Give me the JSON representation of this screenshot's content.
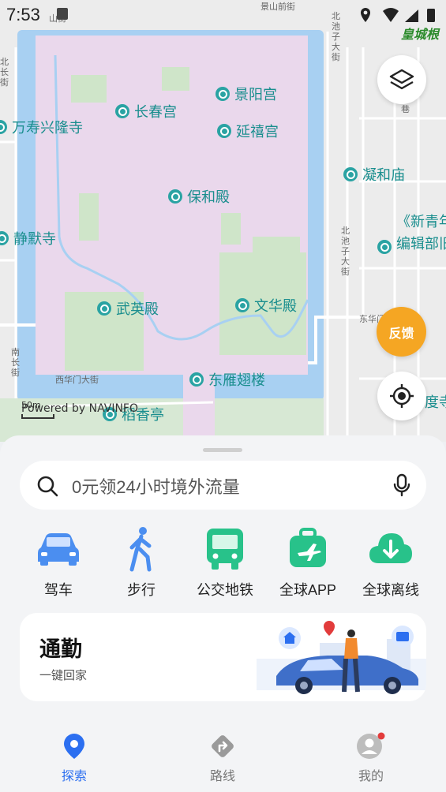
{
  "status_bar": {
    "time": "7:53"
  },
  "map": {
    "pois": [
      {
        "name": "景阳宫"
      },
      {
        "name": "长春宫"
      },
      {
        "name": "万寿兴隆寺"
      },
      {
        "name": "延禧宫"
      },
      {
        "name": "凝和庙"
      },
      {
        "name": "保和殿"
      },
      {
        "name": "《新青年"
      },
      {
        "name": "编辑部旧址"
      },
      {
        "name": "静默寺"
      },
      {
        "name": "武英殿"
      },
      {
        "name": "文华殿"
      },
      {
        "name": "东雁翅楼"
      },
      {
        "name": "稻香亭"
      },
      {
        "name": "度寺"
      }
    ],
    "streets": {
      "jingshan": "景山前街",
      "huangchenggen": "皇城根",
      "beichizi": "北池子大街",
      "beichizi2": "北池子大街",
      "beichang": "北长街",
      "nanchang": "南长街",
      "xihuamen": "西华门大街",
      "donghuamen": "东华门",
      "shan": "山街",
      "xiang": "巷"
    },
    "watermark": "Powered by NAVINFO",
    "scale": "50m"
  },
  "buttons": {
    "feedback": "反馈"
  },
  "search": {
    "placeholder": "0元领24小时境外流量"
  },
  "quick_actions": [
    {
      "label": "驾车"
    },
    {
      "label": "步行"
    },
    {
      "label": "公交地铁"
    },
    {
      "label": "全球APP"
    },
    {
      "label": "全球离线"
    }
  ],
  "commute": {
    "title": "通勤",
    "subtitle": "一键回家"
  },
  "bottom_nav": [
    {
      "label": "探索",
      "active": true
    },
    {
      "label": "路线",
      "active": false
    },
    {
      "label": "我的",
      "active": false
    }
  ],
  "colors": {
    "accent": "#2c6ff0",
    "feedback": "#f5a623",
    "poi": "#2aa3a3",
    "palace": "#ead8ec",
    "moat": "#a8d0f2"
  }
}
